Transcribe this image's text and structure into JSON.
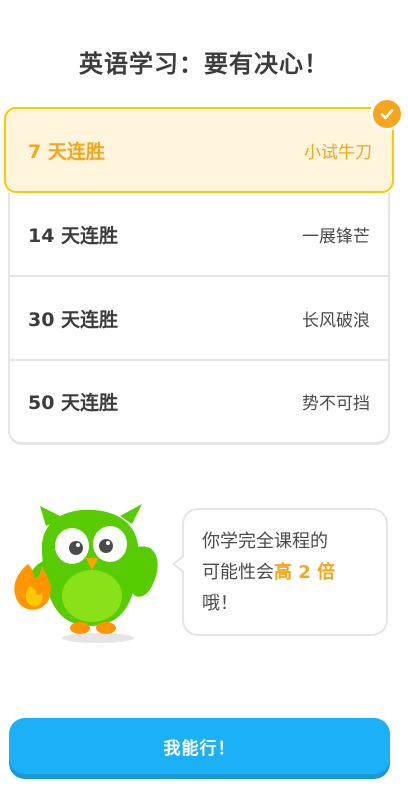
{
  "header": {
    "title": "英语学习：要有决心！"
  },
  "goals": [
    {
      "streak": "7 天连胜",
      "level": "小试牛刀",
      "selected": true
    },
    {
      "streak": "14 天连胜",
      "level": "一展锋芒",
      "selected": false
    },
    {
      "streak": "30 天连胜",
      "level": "长风破浪",
      "selected": false
    },
    {
      "streak": "50 天连胜",
      "level": "势不可挡",
      "selected": false
    }
  ],
  "bubble": {
    "line1": "你学完全课程的",
    "line2_prefix": "可能性会",
    "line2_highlight": "高 2 倍",
    "line3": "哦！"
  },
  "cta": {
    "label": "我能行！"
  },
  "colors": {
    "accent_orange": "#f7a51b",
    "selected_border": "#ffc800",
    "selected_bg": "#fff4dc",
    "cta_blue": "#1cb0f6",
    "owl_green": "#58cc02"
  },
  "icons": {
    "selected_badge": "check-icon",
    "mascot": "owl-mascot"
  }
}
